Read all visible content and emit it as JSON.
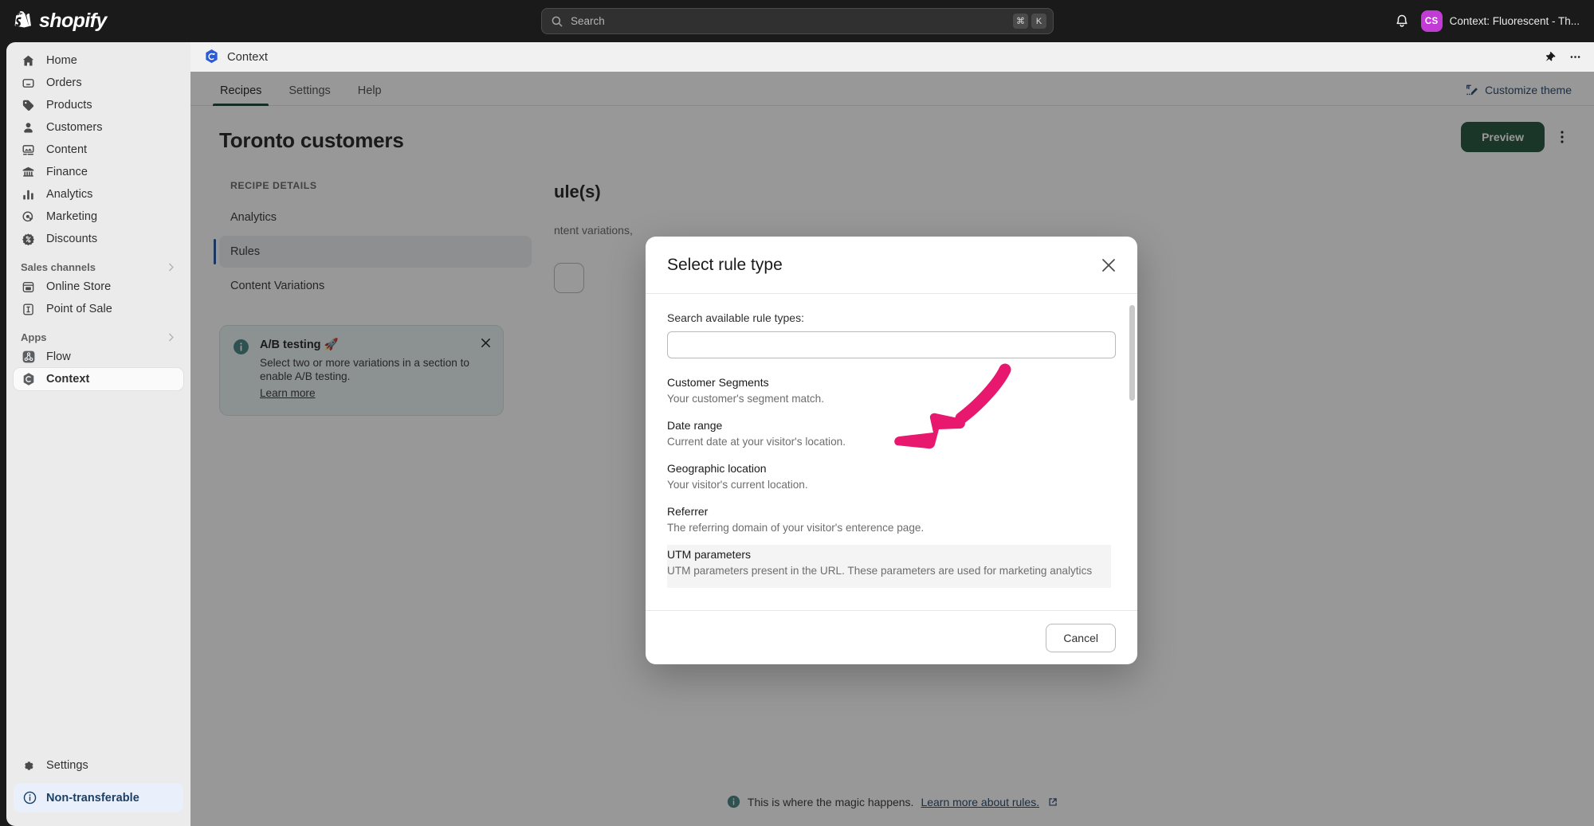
{
  "topbar": {
    "brand": "shopify",
    "search": {
      "placeholder": "Search",
      "shortcut_modifier": "⌘",
      "shortcut_key": "K"
    },
    "notifications_icon": "bell-icon",
    "account": {
      "initials": "CS",
      "name": "Context: Fluorescent - Th..."
    }
  },
  "sidebar": {
    "items": [
      {
        "label": "Home",
        "icon": "home-icon"
      },
      {
        "label": "Orders",
        "icon": "orders-inbox-icon"
      },
      {
        "label": "Products",
        "icon": "product-tag-icon"
      },
      {
        "label": "Customers",
        "icon": "person-icon"
      },
      {
        "label": "Content",
        "icon": "content-image-icon"
      },
      {
        "label": "Finance",
        "icon": "bank-icon"
      },
      {
        "label": "Analytics",
        "icon": "bar-chart-icon"
      },
      {
        "label": "Marketing",
        "icon": "target-cursor-icon"
      },
      {
        "label": "Discounts",
        "icon": "discount-badge-icon"
      }
    ],
    "sections": [
      {
        "title": "Sales channels",
        "chevron": "chevron-right-icon",
        "items": [
          {
            "label": "Online Store",
            "icon": "storefront-icon"
          },
          {
            "label": "Point of Sale",
            "icon": "pos-icon"
          }
        ]
      },
      {
        "title": "Apps",
        "chevron": "chevron-right-icon",
        "items": [
          {
            "label": "Flow",
            "icon": "flow-app-icon"
          },
          {
            "label": "Context",
            "icon": "context-app-icon",
            "active": true
          }
        ]
      }
    ],
    "settings": {
      "label": "Settings",
      "icon": "gear-icon"
    },
    "status_pill": {
      "label": "Non-transferable",
      "icon": "info-circle-icon"
    }
  },
  "app_header": {
    "icon": "context-app-icon",
    "title": "Context",
    "pin_icon": "pin-icon",
    "more_icon": "ellipsis-horizontal-icon"
  },
  "page": {
    "tabs": [
      {
        "label": "Recipes",
        "selected": true
      },
      {
        "label": "Settings",
        "selected": false
      },
      {
        "label": "Help",
        "selected": false
      }
    ],
    "customize_theme": {
      "label": "Customize theme",
      "icon": "theme-edit-icon"
    },
    "title": "Toronto customers",
    "preview_button": "Preview",
    "more_actions_icon": "ellipsis-vertical-icon",
    "recipe_details_heading": "RECIPE DETAILS",
    "recipe_nav": [
      {
        "label": "Analytics",
        "selected": false
      },
      {
        "label": "Rules",
        "selected": true
      },
      {
        "label": "Content Variations",
        "selected": false
      }
    ],
    "ab_banner": {
      "icon": "info-circle-icon",
      "title": "A/B testing 🚀",
      "body": "Select two or more variations in a section to enable A/B testing.",
      "link": "Learn more",
      "close_icon": "close-icon"
    },
    "rules_panel": {
      "title": "ule(s)",
      "subtitle": "ntent variations,"
    },
    "footnote": {
      "icon": "info-circle-icon",
      "text": "This is where the magic happens.",
      "link": "Learn more about rules.",
      "external_icon": "external-link-icon"
    }
  },
  "modal": {
    "title": "Select rule type",
    "close_icon": "close-icon",
    "search_label": "Search available rule types:",
    "search_value": "",
    "search_placeholder": "",
    "rule_types": [
      {
        "name": "Customer Segments",
        "desc": "Your customer's segment match."
      },
      {
        "name": "Date range",
        "desc": "Current date at your visitor's location."
      },
      {
        "name": "Geographic location",
        "desc": "Your visitor's current location."
      },
      {
        "name": "Referrer",
        "desc": "The referring domain of your visitor's enterence page."
      },
      {
        "name": "UTM parameters",
        "desc": "UTM parameters present in the URL. These parameters are used for marketing analytics",
        "highlighted": true
      }
    ],
    "cancel_button": "Cancel",
    "scrollbar": "vertical-scrollbar"
  },
  "annotation": {
    "shape": "arrow-pointing-down-left",
    "color": "#E8186F"
  },
  "colors": {
    "brand_dark": "#1a1a1a",
    "accent_green": "#1a4d34",
    "link_blue": "#1c3f66",
    "avatar_purple": "#c23bd6",
    "annotation_pink": "#E8186F"
  }
}
